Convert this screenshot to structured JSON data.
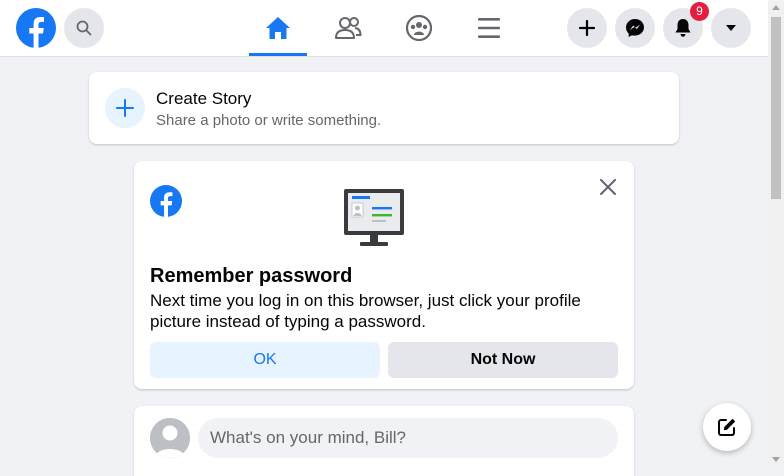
{
  "colors": {
    "brand_blue": "#1877f2",
    "page_bg": "#f0f2f5",
    "notification_red": "#e41e3f"
  },
  "topbar": {
    "logo_icon": "facebook-logo",
    "search_icon": "search-icon",
    "tabs": [
      {
        "name": "home",
        "icon": "home-icon",
        "active": true
      },
      {
        "name": "friends",
        "icon": "friends-icon",
        "active": false
      },
      {
        "name": "groups",
        "icon": "groups-icon",
        "active": false
      },
      {
        "name": "menu",
        "icon": "hamburger-icon",
        "active": false
      }
    ],
    "notification_count": "9"
  },
  "story": {
    "title": "Create Story",
    "subtitle": "Share a photo or write something."
  },
  "remember_password": {
    "title": "Remember password",
    "body": "Next time you log in on this browser, just click your profile picture instead of typing a password.",
    "ok_label": "OK",
    "not_now_label": "Not Now"
  },
  "composer": {
    "placeholder": "What's on your mind, Bill?"
  }
}
